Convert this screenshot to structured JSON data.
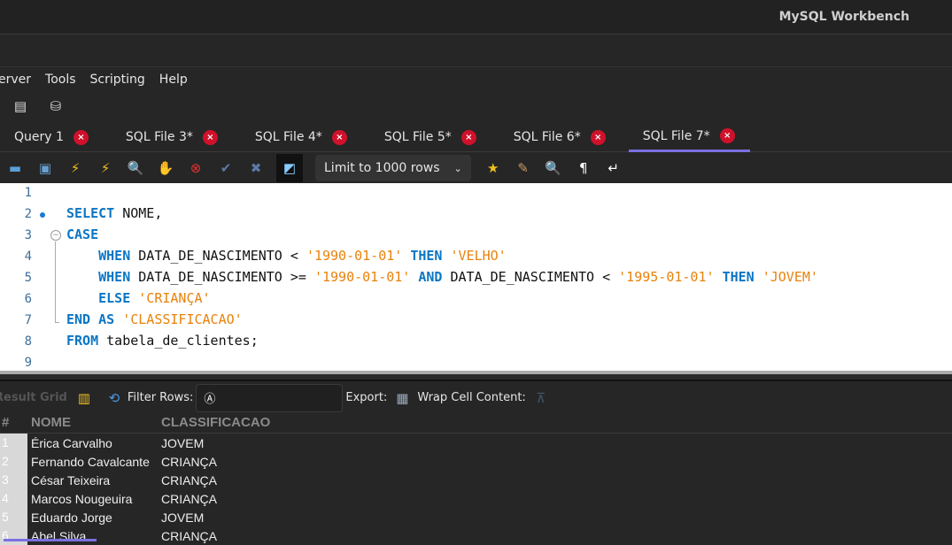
{
  "window": {
    "title": "MySQL Workbench"
  },
  "menu": [
    "erver",
    "Tools",
    "Scripting",
    "Help"
  ],
  "tabs": [
    {
      "label": "Query 1"
    },
    {
      "label": "SQL File 3*"
    },
    {
      "label": "SQL File 4*"
    },
    {
      "label": "SQL File 5*"
    },
    {
      "label": "SQL File 6*",
      "active": false
    },
    {
      "label": "SQL File 7*",
      "active": true
    }
  ],
  "accent": "#7b6fe0",
  "editor_toolbar": {
    "limit_select": "Limit to 1000 rows"
  },
  "editor": {
    "lines": [
      [],
      [
        {
          "t": "SELECT",
          "c": "kw"
        },
        {
          "t": " NOME,",
          "c": "id"
        }
      ],
      [
        {
          "t": "CASE",
          "c": "kw"
        }
      ],
      [
        {
          "t": "    ",
          "c": "id"
        },
        {
          "t": "WHEN",
          "c": "kw"
        },
        {
          "t": " DATA_DE_NASCIMENTO < ",
          "c": "id"
        },
        {
          "t": "'1990-01-01'",
          "c": "str"
        },
        {
          "t": " ",
          "c": "id"
        },
        {
          "t": "THEN",
          "c": "kw"
        },
        {
          "t": " ",
          "c": "id"
        },
        {
          "t": "'VELHO'",
          "c": "str"
        }
      ],
      [
        {
          "t": "    ",
          "c": "id"
        },
        {
          "t": "WHEN",
          "c": "kw"
        },
        {
          "t": " DATA_DE_NASCIMENTO >= ",
          "c": "id"
        },
        {
          "t": "'1990-01-01'",
          "c": "str"
        },
        {
          "t": " ",
          "c": "id"
        },
        {
          "t": "AND",
          "c": "kw"
        },
        {
          "t": " DATA_DE_NASCIMENTO < ",
          "c": "id"
        },
        {
          "t": "'1995-01-01'",
          "c": "str"
        },
        {
          "t": " ",
          "c": "id"
        },
        {
          "t": "THEN",
          "c": "kw"
        },
        {
          "t": " ",
          "c": "id"
        },
        {
          "t": "'JOVEM'",
          "c": "str"
        }
      ],
      [
        {
          "t": "    ",
          "c": "id"
        },
        {
          "t": "ELSE",
          "c": "kw"
        },
        {
          "t": " ",
          "c": "id"
        },
        {
          "t": "'CRIANÇA'",
          "c": "str"
        }
      ],
      [
        {
          "t": "END",
          "c": "kw"
        },
        {
          "t": " ",
          "c": "id"
        },
        {
          "t": "AS",
          "c": "kw"
        },
        {
          "t": " ",
          "c": "id"
        },
        {
          "t": "'CLASSIFICACAO'",
          "c": "str"
        }
      ],
      [
        {
          "t": "FROM",
          "c": "kw"
        },
        {
          "t": " tabela_de_clientes;",
          "c": "id"
        }
      ],
      []
    ]
  },
  "result": {
    "toolbar": {
      "result_grid": "Result Grid",
      "filter_label": "Filter Rows:",
      "filter_value": "",
      "export_label": "Export:",
      "wrap_label": "Wrap Cell Content:"
    },
    "columns": [
      "#",
      "NOME",
      "CLASSIFICACAO"
    ],
    "rows": [
      [
        "1",
        "Érica Carvalho",
        "JOVEM"
      ],
      [
        "2",
        "Fernando Cavalcante",
        "CRIANÇA"
      ],
      [
        "3",
        "César Teixeira",
        "CRIANÇA"
      ],
      [
        "4",
        "Marcos Nougeuira",
        "CRIANÇA"
      ],
      [
        "5",
        "Eduardo Jorge",
        "JOVEM"
      ],
      [
        "6",
        "Abel Silva",
        "CRIANÇA"
      ]
    ]
  }
}
